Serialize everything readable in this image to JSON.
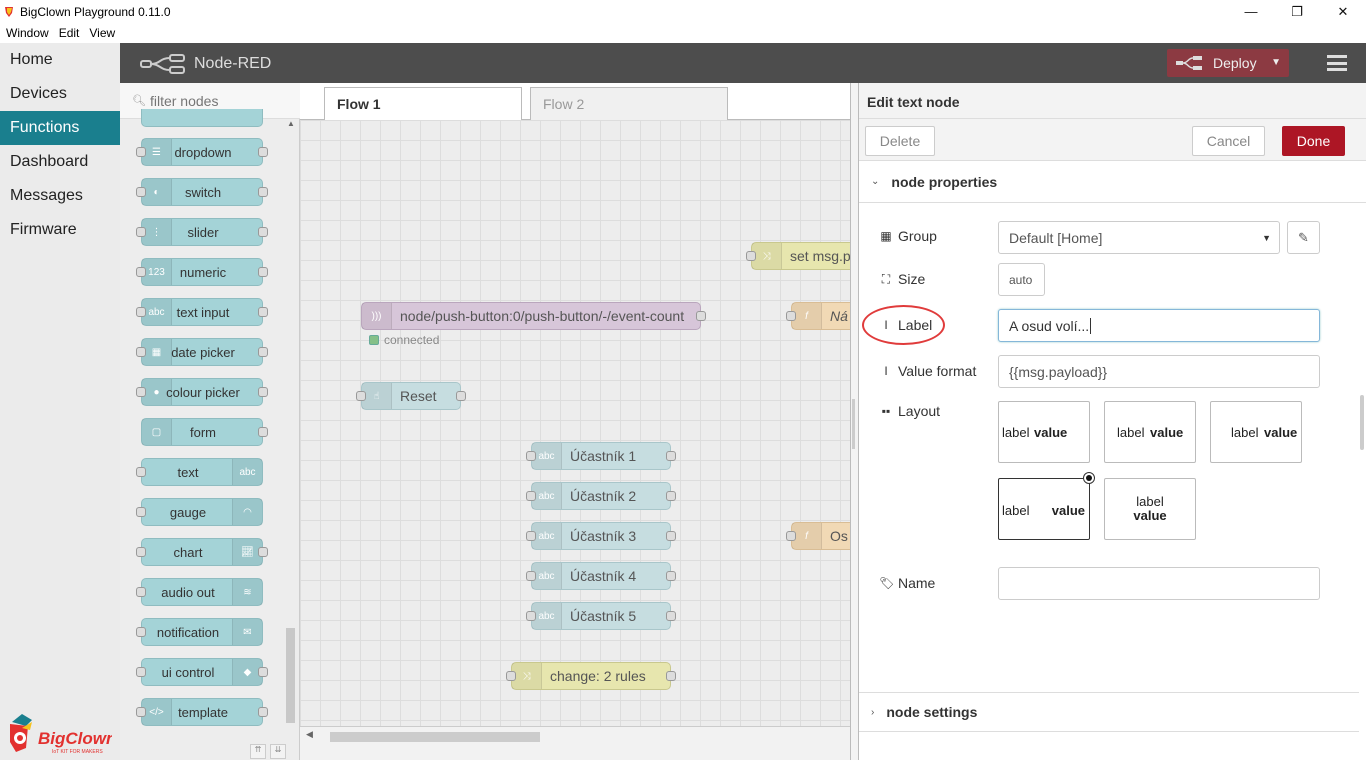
{
  "window": {
    "title": "BigClown Playground 0.11.0",
    "controls": {
      "minimize": "—",
      "maximize": "❐",
      "close": "✕"
    }
  },
  "menubar": {
    "items": [
      "Window",
      "Edit",
      "View"
    ]
  },
  "sidebar": {
    "items": [
      {
        "label": "Home",
        "active": false
      },
      {
        "label": "Devices",
        "active": false
      },
      {
        "label": "Functions",
        "active": true
      },
      {
        "label": "Dashboard",
        "active": false
      },
      {
        "label": "Messages",
        "active": false
      },
      {
        "label": "Firmware",
        "active": false
      }
    ],
    "logo_text": "BigClown",
    "logo_tagline": "IoT KIT FOR MAKERS"
  },
  "header": {
    "app_name": "Node-RED",
    "deploy_label": "Deploy",
    "accent": "#8c3a42"
  },
  "palette": {
    "filter_placeholder": "filter nodes",
    "nodes": [
      "dropdown",
      "switch",
      "slider",
      "numeric",
      "text input",
      "date picker",
      "colour picker",
      "form",
      "text",
      "gauge",
      "chart",
      "audio out",
      "notification",
      "ui control",
      "template"
    ]
  },
  "workspace": {
    "tabs": [
      {
        "label": "Flow 1",
        "active": true
      },
      {
        "label": "Flow 2",
        "active": false
      }
    ],
    "nodes": {
      "setmsg": "set msg.p",
      "mqtt": "node/push-button:0/push-button/-/event-count",
      "fn1": "Ná",
      "reset": "Reset",
      "p1": "Účastník 1",
      "p2": "Účastník 2",
      "p3": "Účastník 3",
      "p4": "Účastník 4",
      "p5": "Účastník 5",
      "fn2": "Os",
      "change": "change: 2 rules"
    },
    "status": "connected"
  },
  "editor": {
    "title": "Edit text node",
    "delete_label": "Delete",
    "cancel_label": "Cancel",
    "done_label": "Done",
    "section_props": "node properties",
    "section_settings": "node settings",
    "group_label": "Group",
    "group_value": "Default [Home]",
    "size_label": "Size",
    "size_value": "auto",
    "label_label": "Label",
    "label_value": "A osud volí...",
    "format_label": "Value format",
    "format_value": "{{msg.payload}}",
    "layout_label": "Layout",
    "name_label": "Name",
    "name_value": "",
    "layout_options": [
      {
        "a": "label",
        "b": "value"
      },
      {
        "a": "label",
        "b": "value"
      },
      {
        "a": "label",
        "b": "value"
      },
      {
        "a": "label",
        "b": "value"
      },
      {
        "a": "label",
        "b": "value"
      }
    ],
    "primary_color": "#ad1625"
  }
}
